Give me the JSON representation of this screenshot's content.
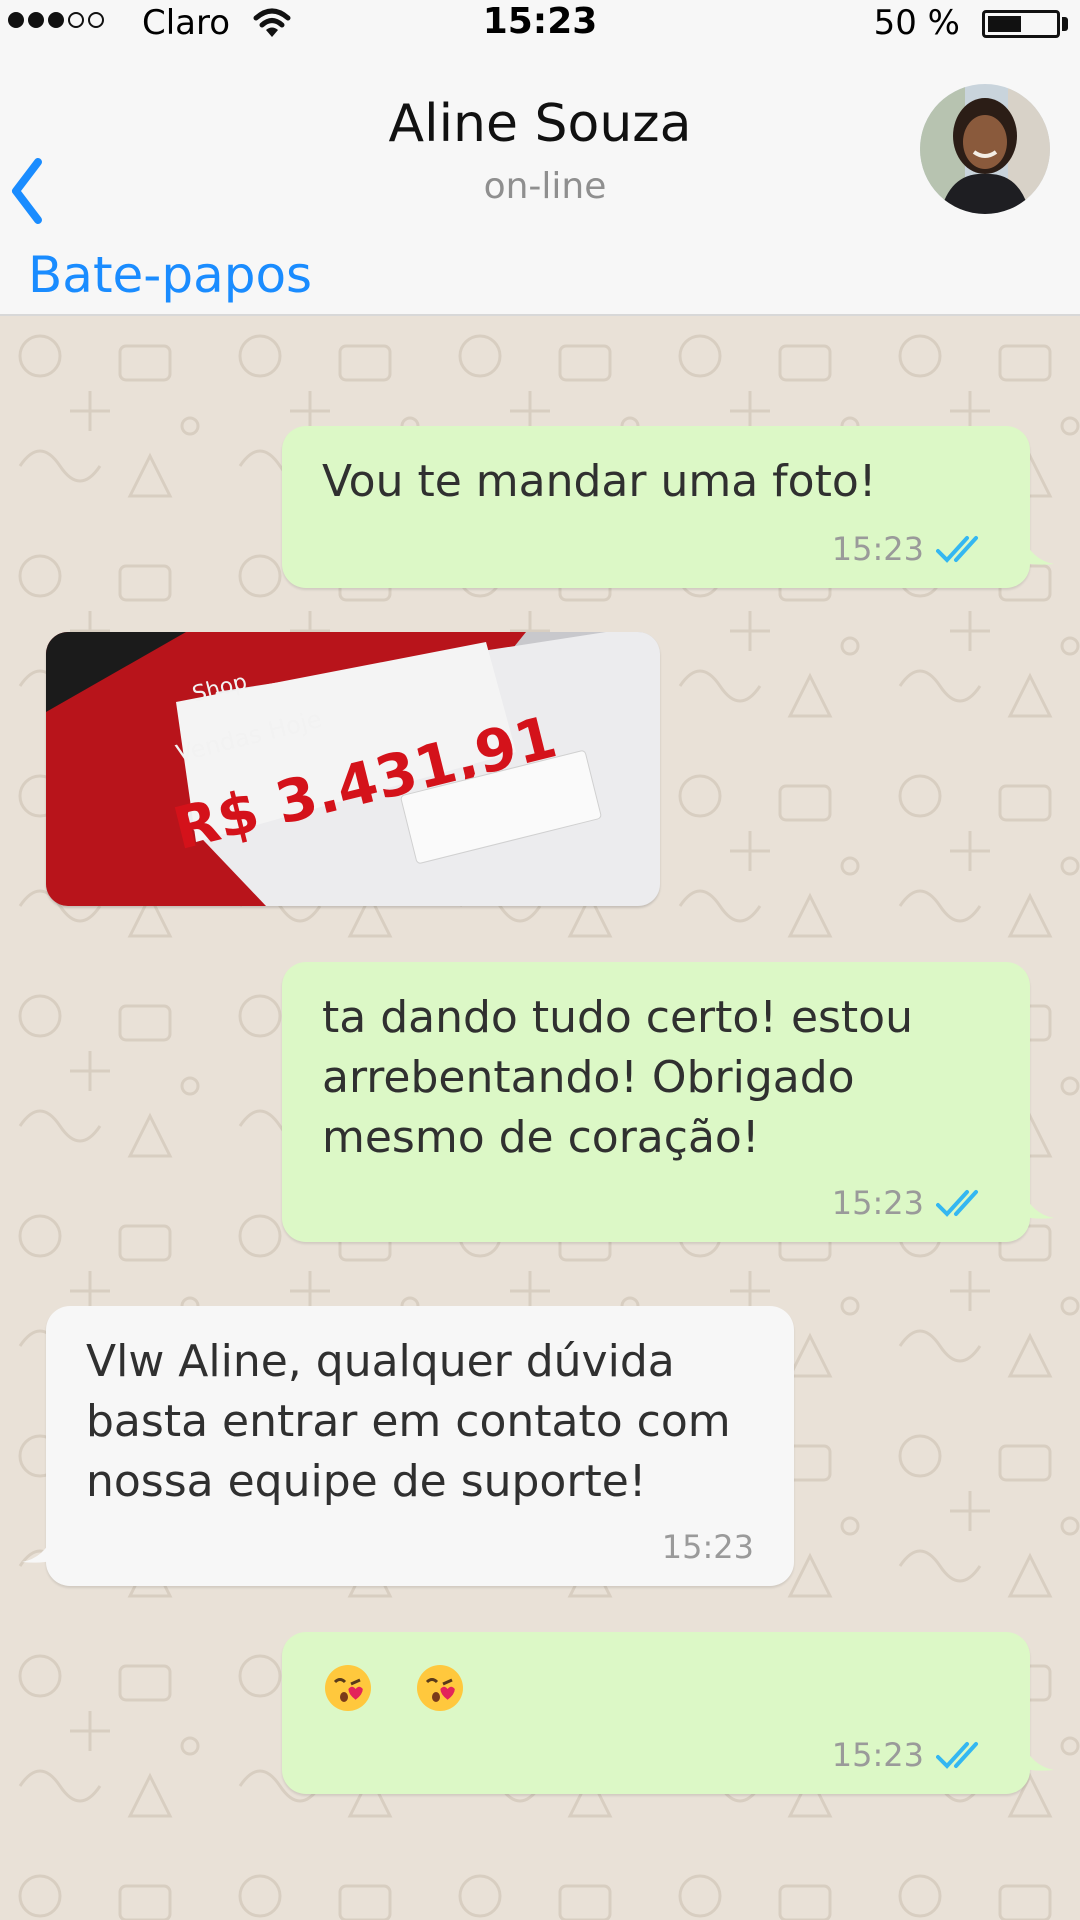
{
  "status_bar": {
    "carrier": "Claro",
    "time": "15:23",
    "battery_percent_text": "50 %",
    "battery_level": 0.5,
    "signal_strength": 3,
    "signal_max": 5
  },
  "header": {
    "back_label": "Bate-papos",
    "contact_name": "Aline Souza",
    "contact_status": "on-line"
  },
  "colors": {
    "accent": "#1a8cff",
    "outgoing_bubble": "#dcf8c6",
    "incoming_bubble": "#f7f7f7",
    "read_ticks": "#34b7f1",
    "chat_background": "#e9e1d7"
  },
  "messages": [
    {
      "direction": "out",
      "text": "Vou te mandar uma foto!",
      "time": "15:23",
      "status": "read"
    },
    {
      "direction": "in",
      "type": "image",
      "image_text": {
        "brand": "Shop",
        "caption": "Vendas Hoje",
        "amount": "R$ 3.431,91"
      }
    },
    {
      "direction": "out",
      "text": "ta dando tudo certo! estou arrebentando! Obrigado mesmo de coração!",
      "time": "15:23",
      "status": "read"
    },
    {
      "direction": "in",
      "text": "Vlw Aline, qualquer dúvida basta entrar em contato com nossa equipe de suporte!",
      "time": "15:23"
    },
    {
      "direction": "out",
      "type": "emoji",
      "emojis": [
        "kissing-face-with-heart",
        "kissing-face-with-heart"
      ],
      "time": "15:23",
      "status": "read"
    }
  ]
}
